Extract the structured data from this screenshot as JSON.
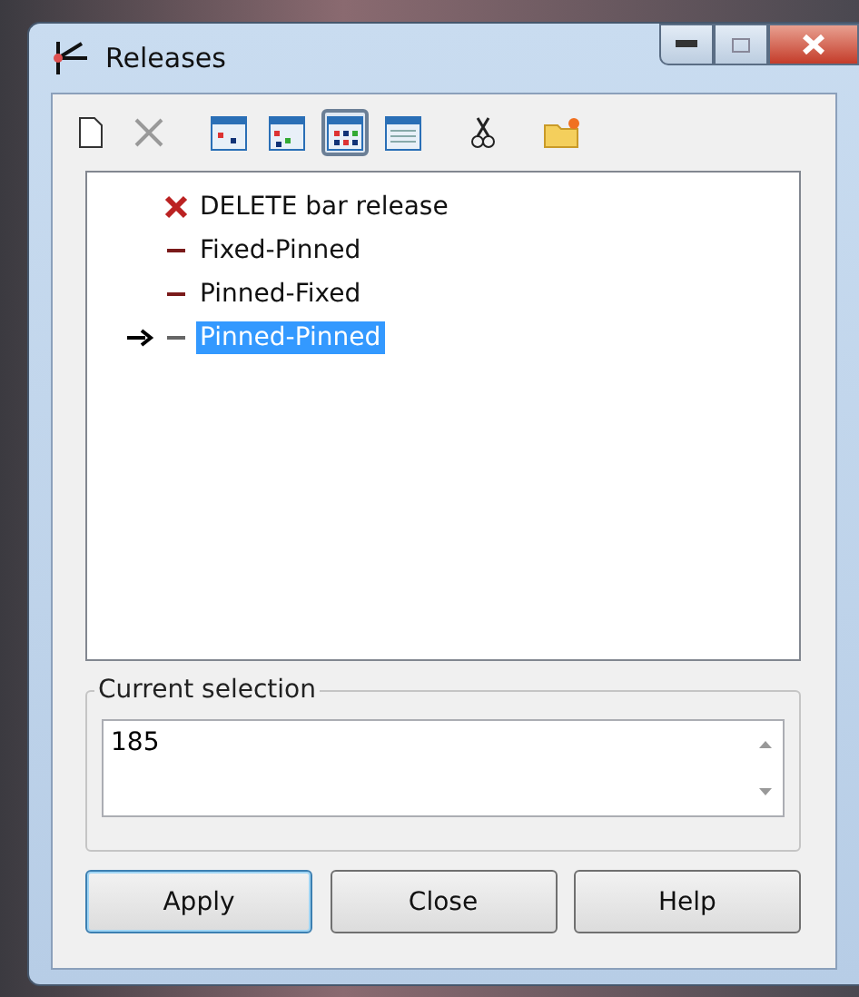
{
  "window": {
    "title": "Releases"
  },
  "toolbar": [
    {
      "kind": "new",
      "selected": false
    },
    {
      "kind": "delete",
      "selected": false,
      "disabled": true
    },
    {
      "kind": "view1",
      "selected": false
    },
    {
      "kind": "view2",
      "selected": false
    },
    {
      "kind": "view3",
      "selected": true
    },
    {
      "kind": "view4",
      "selected": false
    },
    {
      "kind": "cut",
      "selected": false
    },
    {
      "kind": "folder",
      "selected": false
    }
  ],
  "list": [
    {
      "kind": "delete",
      "label": "DELETE bar release",
      "selected": false,
      "current": false
    },
    {
      "kind": "release",
      "label": "Fixed-Pinned",
      "selected": false,
      "current": false
    },
    {
      "kind": "release",
      "label": "Pinned-Fixed",
      "selected": false,
      "current": false
    },
    {
      "kind": "release",
      "label": "Pinned-Pinned",
      "selected": true,
      "current": true
    }
  ],
  "current_selection": {
    "label": "Current selection",
    "value": "185"
  },
  "buttons": [
    {
      "label": "Apply",
      "default": true
    },
    {
      "label": "Close",
      "default": false
    },
    {
      "label": "Help",
      "default": false
    }
  ]
}
